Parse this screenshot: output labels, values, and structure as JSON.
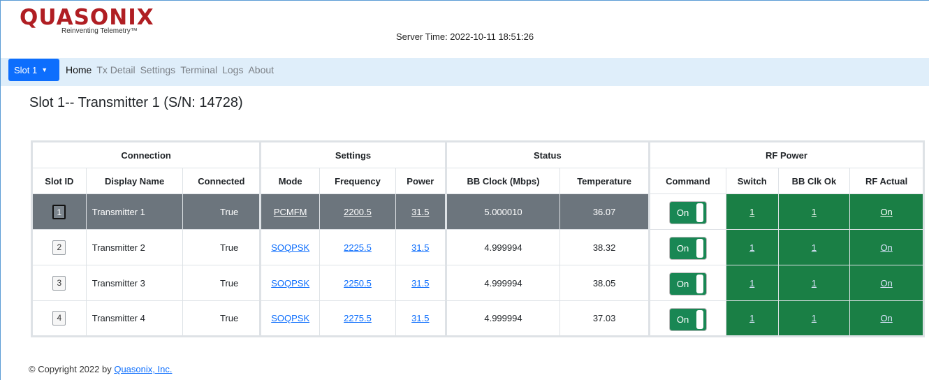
{
  "logo": {
    "name": "QUASONIX",
    "tagline": "Reinventing Telemetry™"
  },
  "server_time": "Server Time: 2022-10-11 18:51:26",
  "nav": {
    "slot_label": "Slot 1",
    "links": [
      "Home",
      "Tx Detail",
      "Settings",
      "Terminal",
      "Logs",
      "About"
    ]
  },
  "page_title": "Slot 1-- Transmitter 1 (S/N: 14728)",
  "table": {
    "groups": [
      "Connection",
      "Settings",
      "Status",
      "RF Power"
    ],
    "columns": [
      "Slot ID",
      "Display Name",
      "Connected",
      "Mode",
      "Frequency",
      "Power",
      "BB Clock (Mbps)",
      "Temperature",
      "Command",
      "Switch",
      "BB Clk Ok",
      "RF Actual"
    ],
    "rows": [
      {
        "slot": "1",
        "name": "Transmitter 1",
        "connected": "True",
        "mode": "PCMFM",
        "frequency": "2200.5",
        "power": "31.5",
        "bb_clock": "5.000010",
        "temperature": "36.07",
        "command": "On",
        "switch": "1",
        "bb_clk_ok": "1",
        "rf_actual": "On"
      },
      {
        "slot": "2",
        "name": "Transmitter 2",
        "connected": "True",
        "mode": "SOQPSK",
        "frequency": "2225.5",
        "power": "31.5",
        "bb_clock": "4.999994",
        "temperature": "38.32",
        "command": "On",
        "switch": "1",
        "bb_clk_ok": "1",
        "rf_actual": "On"
      },
      {
        "slot": "3",
        "name": "Transmitter 3",
        "connected": "True",
        "mode": "SOQPSK",
        "frequency": "2250.5",
        "power": "31.5",
        "bb_clock": "4.999994",
        "temperature": "38.05",
        "command": "On",
        "switch": "1",
        "bb_clk_ok": "1",
        "rf_actual": "On"
      },
      {
        "slot": "4",
        "name": "Transmitter 4",
        "connected": "True",
        "mode": "SOQPSK",
        "frequency": "2275.5",
        "power": "31.5",
        "bb_clock": "4.999994",
        "temperature": "37.03",
        "command": "On",
        "switch": "1",
        "bb_clk_ok": "1",
        "rf_actual": "On"
      }
    ]
  },
  "footer": {
    "prefix": "© Copyright 2022 by ",
    "link": "Quasonix, Inc."
  },
  "colors": {
    "accent": "#0d6efd",
    "nav_bg": "#dfeefa",
    "selected_row": "#6c757d",
    "rf_green": "#1a7f45",
    "logo_red": "#b01e23",
    "logo_blue": "#1f3b8c"
  },
  "icons": {
    "dropdown": "caret-down-icon"
  }
}
